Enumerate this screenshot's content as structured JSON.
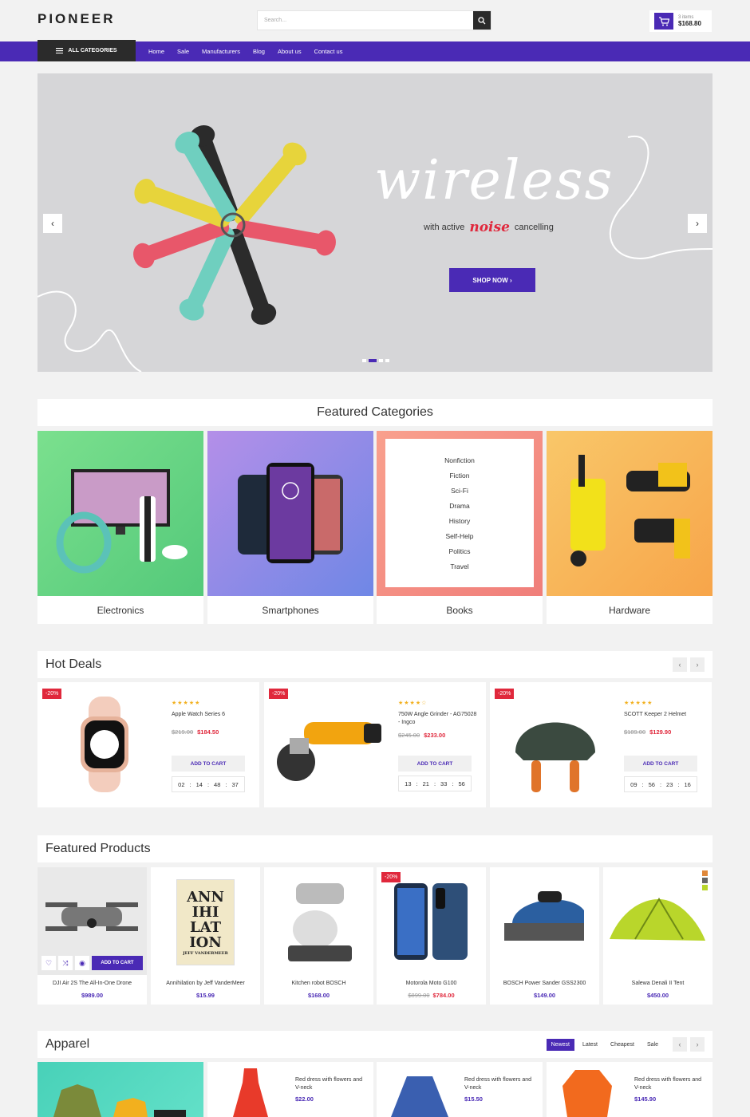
{
  "header": {
    "logo": "PIONEER",
    "search_placeholder": "Search...",
    "cart_items": "3 items",
    "cart_total": "$168.80"
  },
  "nav": {
    "all_categories": "ALL CATEGORIES",
    "links": [
      "Home",
      "Sale",
      "Manufacturers",
      "Blog",
      "About us",
      "Contact us"
    ]
  },
  "hero": {
    "headline": "wireless",
    "sub_before": "with active",
    "sub_noise": "noise",
    "sub_after": "cancelling",
    "cta": "SHOP NOW",
    "cta_arrow": "›",
    "prev": "‹",
    "next": "›"
  },
  "featured_categories": {
    "title": "Featured Categories",
    "items": [
      "Electronics",
      "Smartphones",
      "Books",
      "Hardware"
    ],
    "books_list": [
      "Nonfiction",
      "Fiction",
      "Sci-Fi",
      "Drama",
      "History",
      "Self-Help",
      "Politics",
      "Travel"
    ]
  },
  "hot_deals": {
    "title": "Hot Deals",
    "add_to_cart": "ADD TO CART",
    "items": [
      {
        "badge": "-20%",
        "stars": "★★★★★",
        "name": "Apple Watch Series 6",
        "old": "$219.00",
        "new": "$184.50",
        "timer": [
          "02",
          "14",
          "48",
          "37"
        ]
      },
      {
        "badge": "-20%",
        "stars": "★★★★☆",
        "name": "750W Angle Grinder - AG75028 - Ingco",
        "old": "$245.00",
        "new": "$233.00",
        "timer": [
          "13",
          "21",
          "33",
          "56"
        ]
      },
      {
        "badge": "-20%",
        "stars": "★★★★★",
        "name": "SCOTT Keeper 2 Helmet",
        "old": "$189.00",
        "new": "$129.90",
        "timer": [
          "09",
          "56",
          "23",
          "16"
        ]
      }
    ]
  },
  "featured_products": {
    "title": "Featured Products",
    "hover_add": "ADD TO CART",
    "items": [
      {
        "name": "DJI Air 2S The All-In-One Drone",
        "price": "$989.00"
      },
      {
        "name": "Annihilation by Jeff VanderMeer",
        "price": "$15.99"
      },
      {
        "name": "Kitchen robot BOSCH",
        "price": "$168.00"
      },
      {
        "name": "Motorola Moto G100",
        "old": "$899.00",
        "price": "$784.00",
        "badge": "-20%"
      },
      {
        "name": "BOSCH Power Sander GSS2300",
        "price": "$149.00"
      },
      {
        "name": "Salewa Denali II Tent",
        "price": "$450.00"
      }
    ],
    "book_cover": [
      "ANN",
      "IHI",
      "LAT",
      "ION",
      "JEFF VANDERMEER"
    ]
  },
  "apparel": {
    "title": "Apparel",
    "tabs": [
      "Newest",
      "Latest",
      "Cheapest",
      "Sale"
    ],
    "items": [
      {
        "name": "Red dress with flowers and V-neck",
        "price": "$22.00"
      },
      {
        "name": "Red dress with flowers and V-neck",
        "price": "$15.50"
      },
      {
        "name": "Red dress with flowers and V-neck",
        "price": "$145.90"
      }
    ]
  },
  "colors": {
    "accent": "#4a2ab5",
    "sale": "#e0283c",
    "dark": "#2b2b2b"
  }
}
